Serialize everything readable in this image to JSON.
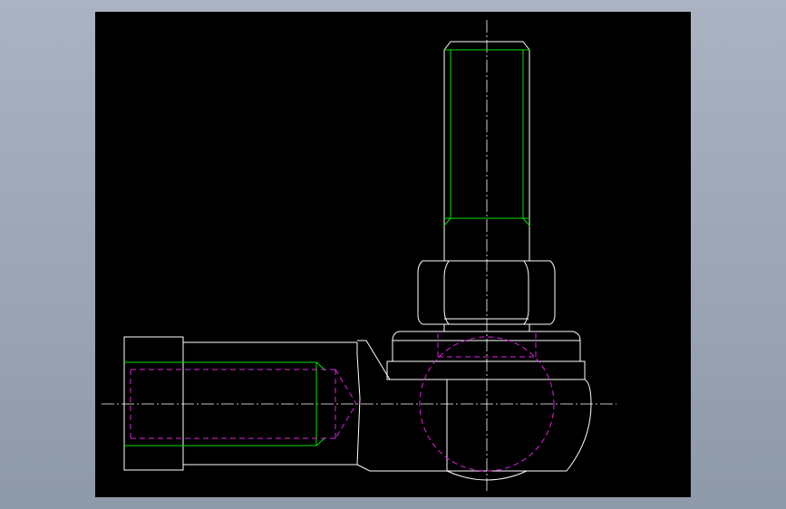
{
  "viewport": {
    "background": "#000000",
    "outer_background": "#a3acbb",
    "colors": {
      "outline": "#ffffff",
      "thread": "#00e000",
      "hidden": "#e020e0",
      "centerline": "#ffffff"
    }
  }
}
